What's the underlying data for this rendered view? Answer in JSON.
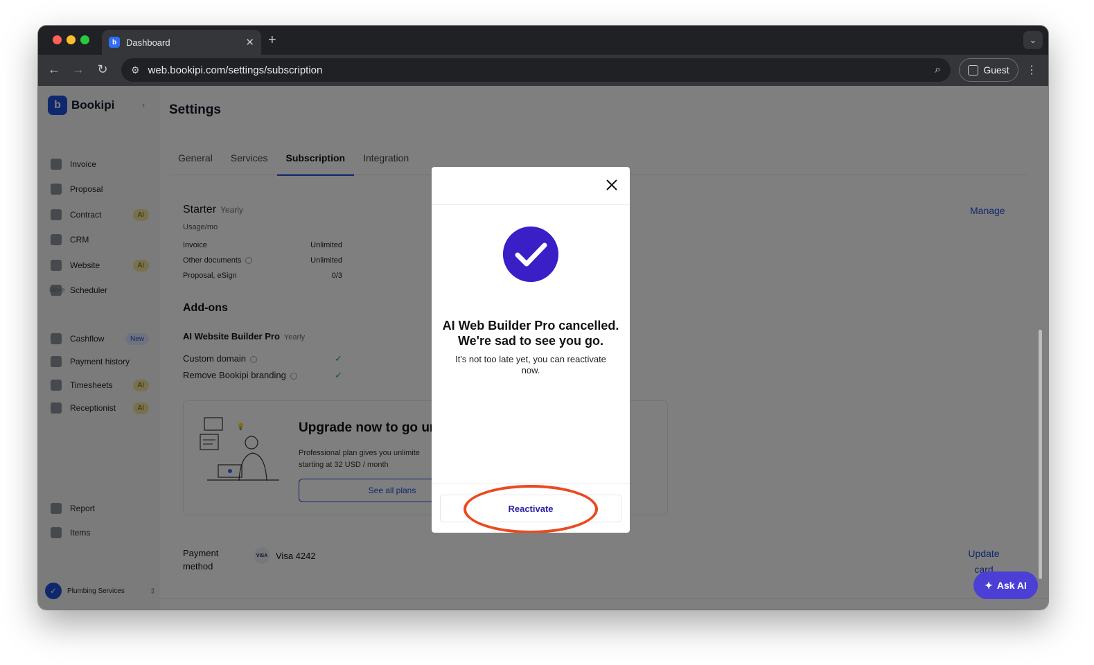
{
  "browser": {
    "tab_title": "Dashboard",
    "url": "web.bookipi.com/settings/subscription",
    "profile_label": "Guest"
  },
  "sidebar": {
    "brand": "Bookipi",
    "items": [
      {
        "label": "Invoice",
        "badge": ""
      },
      {
        "label": "Proposal",
        "badge": ""
      },
      {
        "label": "Contract",
        "badge": "AI"
      },
      {
        "label": "CRM",
        "badge": ""
      },
      {
        "label": "Website",
        "badge": "AI"
      },
      {
        "label": "Scheduler",
        "badge": ""
      }
    ],
    "more_label": "More",
    "more_items": [
      {
        "label": "Cashflow",
        "badge": "New"
      },
      {
        "label": "Payment history",
        "badge": ""
      },
      {
        "label": "Timesheets",
        "badge": "AI"
      },
      {
        "label": "Receptionist",
        "badge": "AI"
      }
    ],
    "bottom_items": [
      {
        "label": "Report"
      },
      {
        "label": "Items"
      }
    ],
    "workspace": "Plumbing Services"
  },
  "settings": {
    "title": "Settings",
    "tabs": [
      "General",
      "Services",
      "Subscription",
      "Integration"
    ],
    "plan": {
      "name": "Starter",
      "period": "Yearly",
      "usage_label": "Usage/mo",
      "rows": [
        {
          "label": "Invoice",
          "value": "Unlimited"
        },
        {
          "label": "Other documents",
          "value": "Unlimited"
        },
        {
          "label": "Proposal, eSign",
          "value": "0/3"
        }
      ],
      "manage_label": "Manage"
    },
    "addons": {
      "title": "Add-ons",
      "name": "AI Website Builder Pro",
      "period": "Yearly",
      "features": [
        "Custom domain",
        "Remove Bookipi branding"
      ]
    },
    "upgrade": {
      "title": "Upgrade now to go ur",
      "desc_line1": "Professional plan gives you unlimite",
      "desc_line2": "starting at 32 USD / month",
      "button": "See all plans"
    },
    "payment": {
      "label_line1": "Payment",
      "label_line2": "method",
      "card_brand": "VISA",
      "card": "Visa 4242",
      "update_line1": "Update",
      "update_line2": "card"
    }
  },
  "ask_ai_label": "Ask AI",
  "modal": {
    "title_line1": "AI Web Builder Pro cancelled.",
    "title_line2": "We're sad to see you go.",
    "subtitle": "It's not too late yet, you can reactivate now.",
    "button": "Reactivate"
  },
  "colors": {
    "brand": "#1e4fd8",
    "check_circle": "#3a1fc6",
    "annotation": "#ea4a1f"
  }
}
